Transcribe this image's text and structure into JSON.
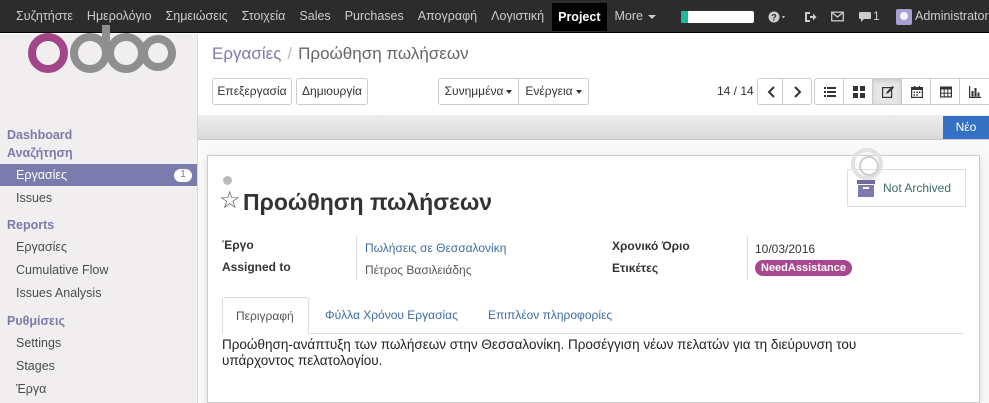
{
  "topbar": {
    "menu": [
      "Συζητήστε",
      "Ημερολόγιο",
      "Σημειώσεις",
      "Στοιχεία",
      "Sales",
      "Purchases",
      "Απογραφή",
      "Λογιστική"
    ],
    "active_app": "Project",
    "more_label": "More",
    "progress_fraction": 0.1,
    "chat_count": "1",
    "user": "Administrator"
  },
  "sidebar": {
    "dashboard_label": "Dashboard",
    "search_label": "Αναζήτηση",
    "tasks_active_label": "Εργασίες",
    "tasks_badge": "1",
    "issues_label": "Issues",
    "reports_label": "Reports",
    "report_items": [
      "Εργασίες",
      "Cumulative Flow",
      "Issues Analysis"
    ],
    "settings_label": "Ρυθμίσεις",
    "settings_items": [
      "Settings",
      "Stages",
      "Έργα"
    ]
  },
  "control": {
    "breadcrumb_parent": "Εργασίες",
    "breadcrumb_sep": "/",
    "breadcrumb_current": "Προώθηση πωλήσεων",
    "edit_label": "Επεξεργασία",
    "create_label": "Δημιουργία",
    "attachments_label": "Συνημμένα",
    "action_label": "Ενέργεια",
    "pager": "14 / 14",
    "new_label": "Νέο"
  },
  "form": {
    "title": "Προώθηση πωλήσεων",
    "archive_label": "Not Archived",
    "project_label": "Έργο",
    "project_value": "Πωλήσεις σε Θεσσαλονίκη",
    "assigned_label": "Assigned to",
    "assigned_value": "Πέτρος Βασιλειάδης",
    "deadline_label": "Χρονικό Όριο",
    "deadline_value": "10/03/2016",
    "tags_label": "Ετικέτες",
    "tag_value": "NeedAssistance",
    "tabs": [
      "Περιγραφή",
      "Φύλλα Χρόνου Εργασίας",
      "Επιπλέον πληροφορίες"
    ],
    "description": "Προώθηση-ανάπτυξη των πωλήσεων στην Θεσσαλονίκη. Προσέγγιση νέων πελατών για τη διεύρυνση του υπάρχοντος πελατολογίου."
  },
  "colors": {
    "brand": "#7c7bad",
    "primary_button": "#3470c4",
    "tag": "#a8478f",
    "progress": "#21b799"
  }
}
